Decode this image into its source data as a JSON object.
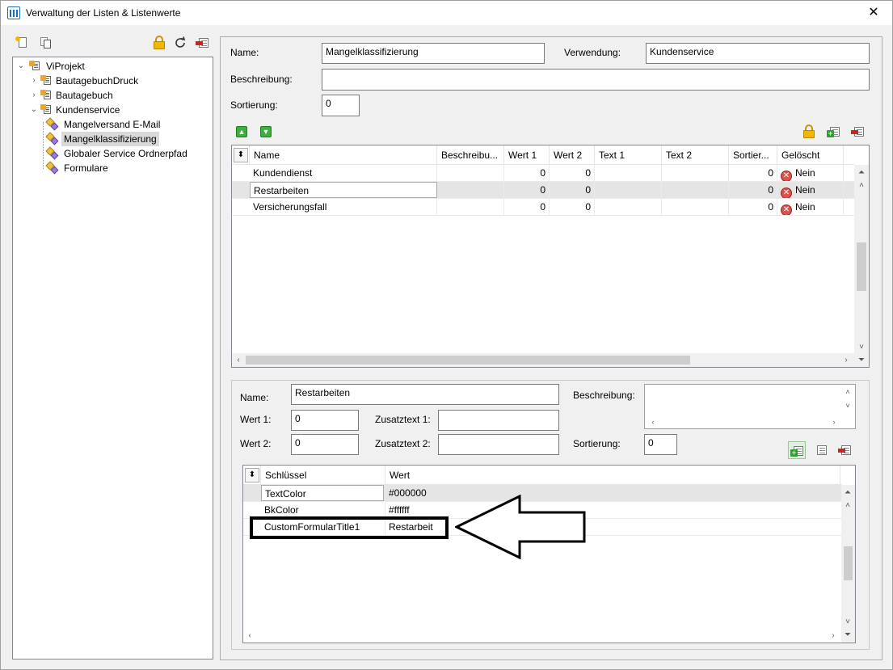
{
  "window": {
    "title": "Verwaltung der Listen & Listenwerte",
    "close_glyph": "✕"
  },
  "tree": {
    "root": "ViProjekt",
    "nodes": [
      {
        "label": "BautagebuchDruck",
        "expand": "›"
      },
      {
        "label": "Bautagebuch",
        "expand": "›"
      },
      {
        "label": "Kundenservice",
        "expand": "⌄"
      }
    ],
    "children": [
      "Mangelversand E-Mail",
      "Mangelklassifizierung",
      "Globaler Service Ordnerpfad",
      "Formulare"
    ],
    "root_expand": "⌄"
  },
  "list_form": {
    "name_label": "Name:",
    "name_value": "Mangelklassifizierung",
    "verwendung_label": "Verwendung:",
    "verwendung_value": "Kundenservice",
    "beschreibung_label": "Beschreibung:",
    "beschreibung_value": "",
    "sortierung_label": "Sortierung:",
    "sortierung_value": "0"
  },
  "values_grid": {
    "sort_glyph": "⬍",
    "columns": [
      "Name",
      "Beschreibu...",
      "Wert 1",
      "Wert 2",
      "Text 1",
      "Text 2",
      "Sortier...",
      "Gelöscht"
    ],
    "rows": [
      {
        "name": "Kundendienst",
        "beschreibung": "",
        "wert1": "0",
        "wert2": "0",
        "text1": "",
        "text2": "",
        "sortierung": "0",
        "geloescht": "Nein"
      },
      {
        "name": "Restarbeiten",
        "beschreibung": "",
        "wert1": "0",
        "wert2": "0",
        "text1": "",
        "text2": "",
        "sortierung": "0",
        "geloescht": "Nein"
      },
      {
        "name": "Versicherungsfall",
        "beschreibung": "",
        "wert1": "0",
        "wert2": "0",
        "text1": "",
        "text2": "",
        "sortierung": "0",
        "geloescht": "Nein"
      }
    ],
    "delete_glyph": "✕",
    "scroll_top": "⏶",
    "scroll_up": "˄",
    "scroll_down": "˅",
    "scroll_bottom": "⏷",
    "scroll_left": "‹",
    "scroll_right": "›"
  },
  "value_form": {
    "name_label": "Name:",
    "name_value": "Restarbeiten",
    "beschreibung_label": "Beschreibung:",
    "wert1_label": "Wert 1:",
    "wert1_value": "0",
    "wert2_label": "Wert 2:",
    "wert2_value": "0",
    "zusatztext1_label": "Zusatztext 1:",
    "zusatztext1_value": "",
    "zusatztext2_label": "Zusatztext 2:",
    "zusatztext2_value": "",
    "sortierung_label": "Sortierung:",
    "sortierung_value": "0"
  },
  "props_grid": {
    "columns": [
      "Schlüssel",
      "Wert"
    ],
    "rows": [
      {
        "key": "TextColor",
        "value": "#000000"
      },
      {
        "key": "BkColor",
        "value": "#ffffff"
      },
      {
        "key": "CustomFormularTitle1",
        "value": "Restarbeit"
      }
    ]
  },
  "colors": {
    "accent": "#1c6dbf",
    "selection": "#d9d9d9",
    "row_selected": "#e5e5e5"
  },
  "icons": [
    "new-list-icon",
    "copy-list-icon",
    "lock-icon",
    "refresh-icon",
    "delete-icon",
    "move-up-icon",
    "move-down-icon",
    "add-row-icon",
    "delete-row-icon",
    "edit-row-icon",
    "delete-error-icon",
    "arrow-annotation"
  ]
}
